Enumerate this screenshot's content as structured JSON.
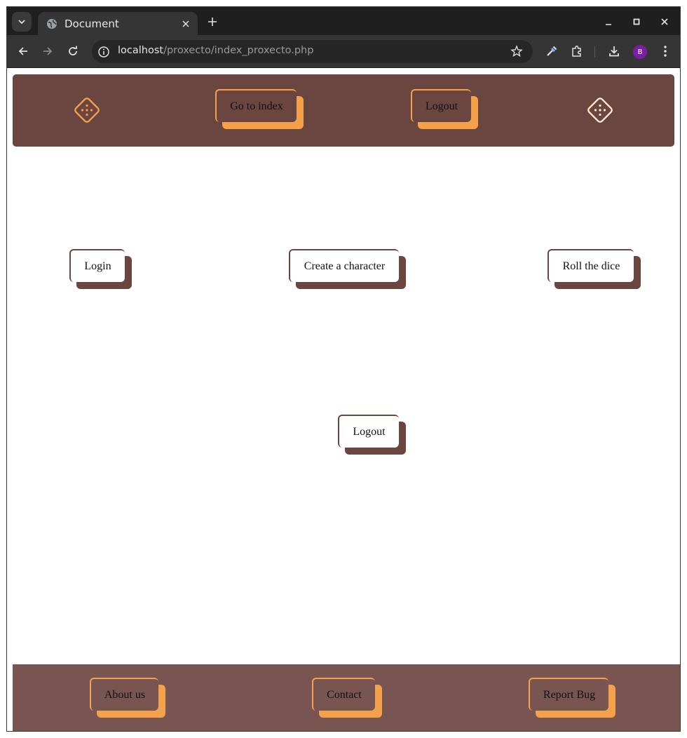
{
  "browser": {
    "tab_title": "Document",
    "url_host": "localhost",
    "url_path": "/proxecto/index_proxecto.php",
    "profile_initial": "B"
  },
  "header": {
    "left_icon": "dice-icon",
    "right_icon": "dice-icon",
    "buttons": [
      {
        "label": "Go to index"
      },
      {
        "label": "Logout"
      }
    ]
  },
  "main": {
    "buttons": [
      {
        "label": "Login"
      },
      {
        "label": "Create a character"
      },
      {
        "label": "Roll the dice"
      },
      {
        "label": "Logout"
      }
    ]
  },
  "footer": {
    "links": [
      {
        "label": "About us"
      },
      {
        "label": "Contact"
      },
      {
        "label": "Report Bug"
      }
    ]
  },
  "colors": {
    "header_bg": "#6b4540",
    "footer_bg": "#785550",
    "accent_orange": "#f5a04a",
    "dice_left": "#f5a04a",
    "dice_right": "#fde8c8"
  }
}
